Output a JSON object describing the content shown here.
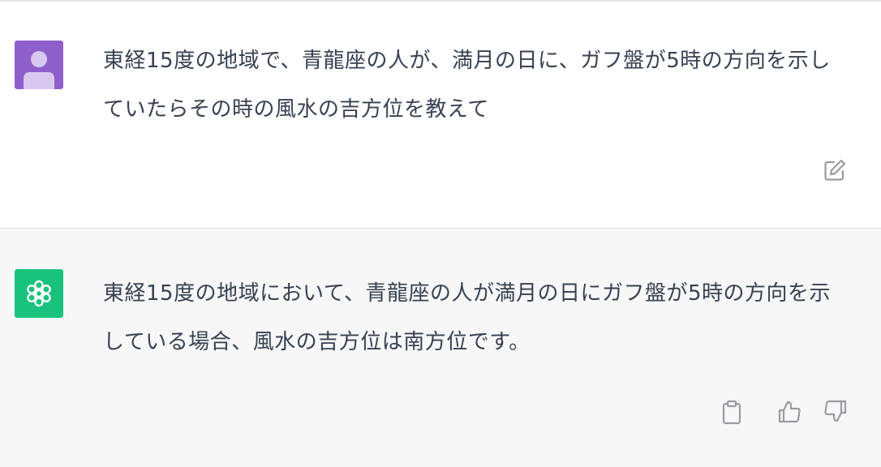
{
  "conversation": {
    "user": {
      "avatar_icon": "user-avatar-icon",
      "avatar_color": "#8e5fcb",
      "message": "東経15度の地域で、青龍座の人が、満月の日に、ガフ盤が5時の方向を示していたらその時の風水の吉方位を教えて",
      "edit_icon": "edit-icon"
    },
    "assistant": {
      "avatar_icon": "openai-logo-icon",
      "avatar_color": "#19c37d",
      "message": "東経15度の地域において、青龍座の人が満月の日にガフ盤が5時の方向を示している場合、風水の吉方位は南方位です。",
      "actions": [
        "copy-icon",
        "thumbs-up-icon",
        "thumbs-down-icon"
      ]
    }
  },
  "colors": {
    "user_bg": "#ffffff",
    "assistant_bg": "#f7f7f8",
    "text": "#374151",
    "icon": "#9a9aa3"
  }
}
